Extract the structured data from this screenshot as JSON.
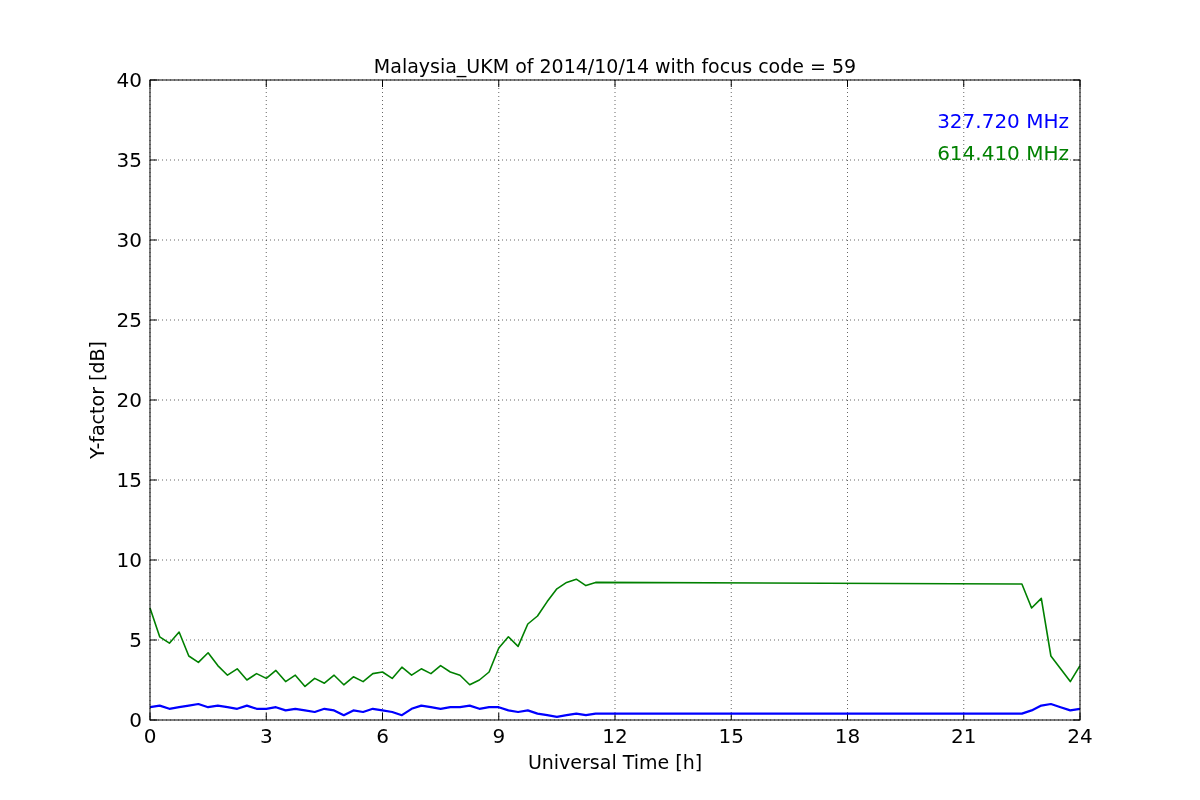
{
  "chart_data": {
    "type": "line",
    "grid": true,
    "title": "Malaysia_UKM of 2014/10/14 with focus code = 59",
    "xlabel": "Universal Time [h]",
    "ylabel": "Y-factor [dB]",
    "xlim": [
      0,
      24
    ],
    "ylim": [
      0,
      40
    ],
    "xticks": [
      0,
      3,
      6,
      9,
      12,
      15,
      18,
      21,
      24
    ],
    "yticks": [
      0,
      5,
      10,
      15,
      20,
      25,
      30,
      35,
      40
    ],
    "x": [
      0,
      0.25,
      0.5,
      0.75,
      1,
      1.25,
      1.5,
      1.75,
      2,
      2.25,
      2.5,
      2.75,
      3,
      3.25,
      3.5,
      3.75,
      4,
      4.25,
      4.5,
      4.75,
      5,
      5.25,
      5.5,
      5.75,
      6,
      6.25,
      6.5,
      6.75,
      7,
      7.25,
      7.5,
      7.75,
      8,
      8.25,
      8.5,
      8.75,
      9,
      9.25,
      9.5,
      9.75,
      10,
      10.25,
      10.5,
      10.75,
      11,
      11.25,
      11.5,
      22.5,
      22.75,
      23,
      23.25,
      23.5,
      23.75,
      24
    ],
    "series": [
      {
        "name": "327.720 MHz",
        "color": "#0000ff",
        "values": [
          0.8,
          0.9,
          0.7,
          0.8,
          0.9,
          1.0,
          0.8,
          0.9,
          0.8,
          0.7,
          0.9,
          0.7,
          0.7,
          0.8,
          0.6,
          0.7,
          0.6,
          0.5,
          0.7,
          0.6,
          0.3,
          0.6,
          0.5,
          0.7,
          0.6,
          0.5,
          0.3,
          0.7,
          0.9,
          0.8,
          0.7,
          0.8,
          0.8,
          0.9,
          0.7,
          0.8,
          0.8,
          0.6,
          0.5,
          0.6,
          0.4,
          0.3,
          0.2,
          0.3,
          0.4,
          0.3,
          0.4,
          0.4,
          0.6,
          0.9,
          1.0,
          0.8,
          0.6,
          0.7
        ]
      },
      {
        "name": "614.410 MHz",
        "color": "#008000",
        "values": [
          7,
          5.2,
          4.8,
          5.5,
          4,
          3.6,
          4.2,
          3.4,
          2.8,
          3.2,
          2.5,
          2.9,
          2.6,
          3.1,
          2.4,
          2.8,
          2.1,
          2.6,
          2.3,
          2.8,
          2.2,
          2.7,
          2.4,
          2.9,
          3.0,
          2.6,
          3.3,
          2.8,
          3.2,
          2.9,
          3.4,
          3.0,
          2.8,
          2.2,
          2.5,
          3.0,
          4.5,
          5.2,
          4.6,
          6.0,
          6.5,
          7.4,
          8.2,
          8.6,
          8.8,
          8.4,
          8.6,
          8.5,
          7.0,
          7.6,
          4.0,
          3.2,
          2.4,
          3.4
        ]
      }
    ]
  }
}
